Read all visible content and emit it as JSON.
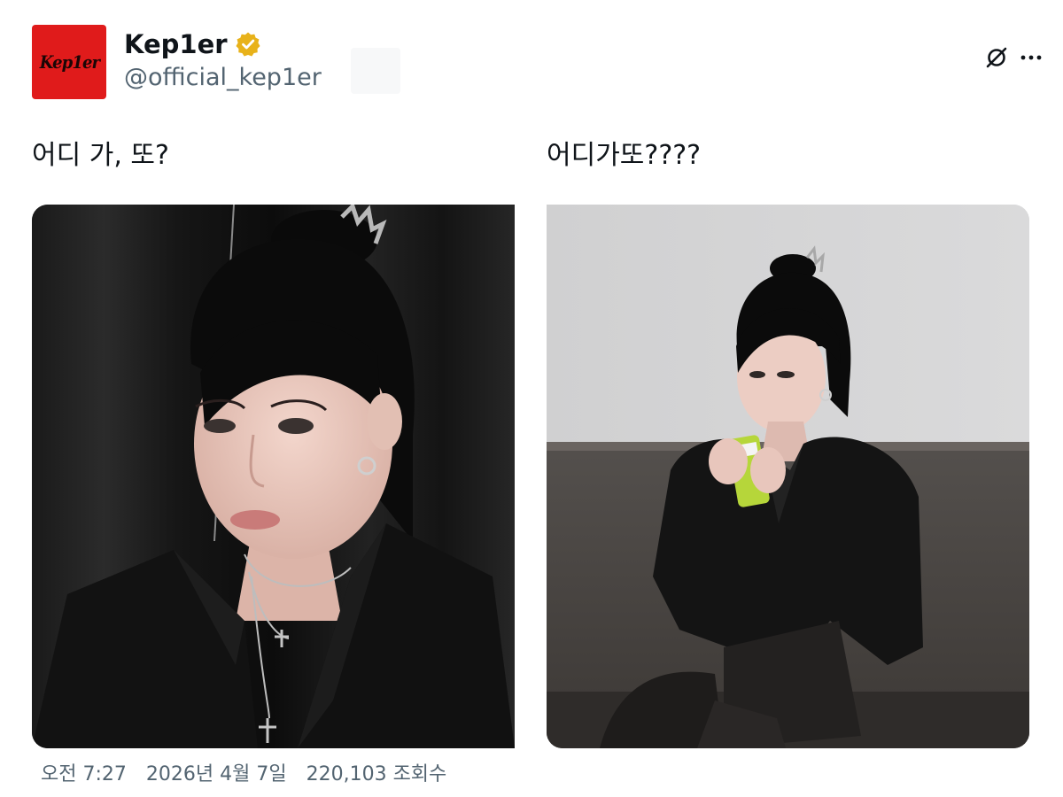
{
  "account": {
    "display_name": "Kep1er",
    "handle": "@official_kep1er",
    "avatar_text": "Kep1er",
    "avatar_color": "#e01b1b",
    "verified_color": "#e8b21a"
  },
  "icons": {
    "grok": "grok-icon",
    "more": "more-icon"
  },
  "posts": {
    "left_text": "어디 가, 또?",
    "right_text": "어디가또????"
  },
  "meta": {
    "time": "오전 7:27",
    "date": "2026년 4월 7일",
    "views": "220,103 조회수"
  }
}
